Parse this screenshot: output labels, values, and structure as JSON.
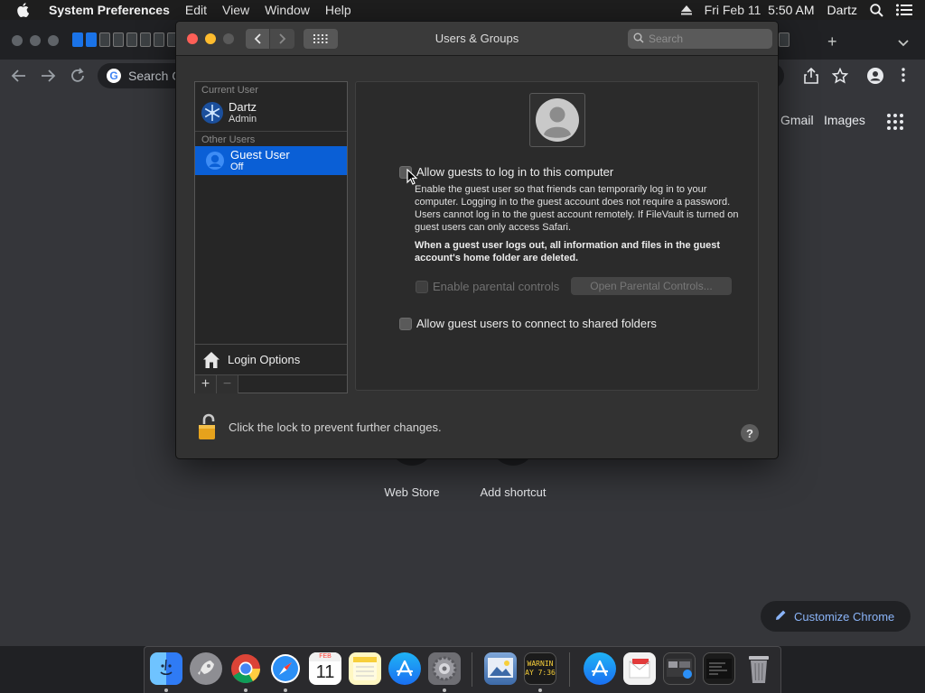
{
  "menubar": {
    "app_name": "System Preferences",
    "items": [
      "Edit",
      "View",
      "Window",
      "Help"
    ],
    "datetime": "Fri Feb 11  5:50 AM",
    "user": "Dartz"
  },
  "chrome": {
    "omnibox_placeholder": "Search G",
    "links": {
      "gmail": "Gmail",
      "images": "Images"
    },
    "shortcuts": [
      "Web Store",
      "Add shortcut"
    ],
    "customize_label": "Customize Chrome"
  },
  "prefs": {
    "title": "Users & Groups",
    "search_placeholder": "Search",
    "sections": {
      "current": "Current User",
      "other": "Other Users"
    },
    "current_user": {
      "name": "Dartz",
      "role": "Admin"
    },
    "other_users": [
      {
        "name": "Guest User",
        "role": "Off"
      }
    ],
    "login_options": "Login Options",
    "add_label": "+",
    "remove_label": "−",
    "allow_login_label": "Allow guests to log in to this computer",
    "description": "Enable the guest user so that friends can temporarily log in to your computer. Logging in to the guest account does not require a password. Users cannot log in to the guest account remotely. If FileVault is turned on guest users can only access Safari.",
    "warning": "When a guest user logs out, all information and files in the guest account's home folder are deleted.",
    "parental_controls_label": "Enable parental controls",
    "open_parental_button": "Open Parental Controls...",
    "shared_folders_label": "Allow guest users to connect to shared folders",
    "lock_message": "Click the lock to prevent further changes.",
    "help_label": "?"
  },
  "dock": {
    "calendar_month": "FEB",
    "calendar_day": "11",
    "console_text_1": "WARNIN",
    "console_text_2": "AY 7:36"
  },
  "colors": {
    "selection": "#0a5fd6",
    "close": "#fe5f57",
    "minimize": "#febc2e",
    "accent_link": "#8ab4f8"
  }
}
